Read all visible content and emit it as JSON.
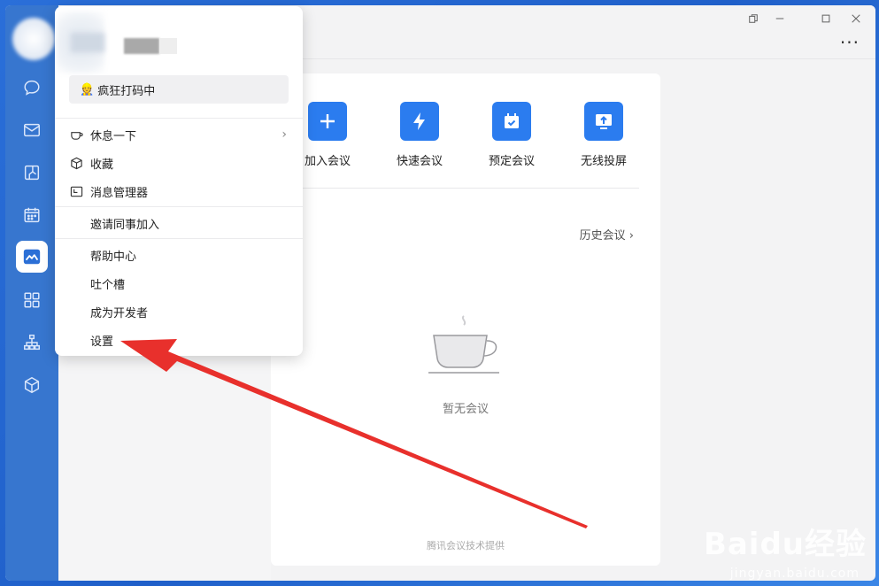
{
  "window": {
    "controls": [
      "pin",
      "minimize",
      "maximize",
      "close"
    ],
    "more_label": "···"
  },
  "sidebar": {
    "items": [
      {
        "name": "chat",
        "icon": "chat-bubble-icon"
      },
      {
        "name": "mail",
        "icon": "mail-icon"
      },
      {
        "name": "docs",
        "icon": "docs-icon"
      },
      {
        "name": "calendar",
        "icon": "calendar-icon"
      },
      {
        "name": "meeting",
        "icon": "meeting-icon",
        "active": true
      },
      {
        "name": "workbench",
        "icon": "grid-icon"
      },
      {
        "name": "contacts",
        "icon": "org-chart-icon"
      },
      {
        "name": "apps",
        "icon": "cube-icon"
      }
    ],
    "accent": "#3776cf"
  },
  "popup": {
    "status": {
      "emoji": "👷",
      "text": "疯狂打码中"
    },
    "items": [
      {
        "label": "休息一下",
        "icon": "coffee-cup-icon",
        "has_submenu": true
      },
      {
        "label": "收藏",
        "icon": "box-icon"
      },
      {
        "label": "消息管理器",
        "icon": "clock-window-icon"
      },
      {
        "label": "邀请同事加入"
      },
      {
        "label": "帮助中心"
      },
      {
        "label": "吐个槽"
      },
      {
        "label": "成为开发者"
      },
      {
        "label": "设置"
      }
    ]
  },
  "meeting": {
    "actions": [
      {
        "label": "加入会议",
        "icon": "plus-icon"
      },
      {
        "label": "快速会议",
        "icon": "lightning-icon"
      },
      {
        "label": "预定会议",
        "icon": "calendar-check-icon"
      },
      {
        "label": "无线投屏",
        "icon": "screen-cast-icon"
      }
    ],
    "history_link": "历史会议",
    "empty_text": "暂无会议",
    "footer": "腾讯会议技术提供",
    "accent": "#2b7cef"
  },
  "watermark": {
    "main": "Baidu经验",
    "sub": "jingyan.baidu.com"
  }
}
